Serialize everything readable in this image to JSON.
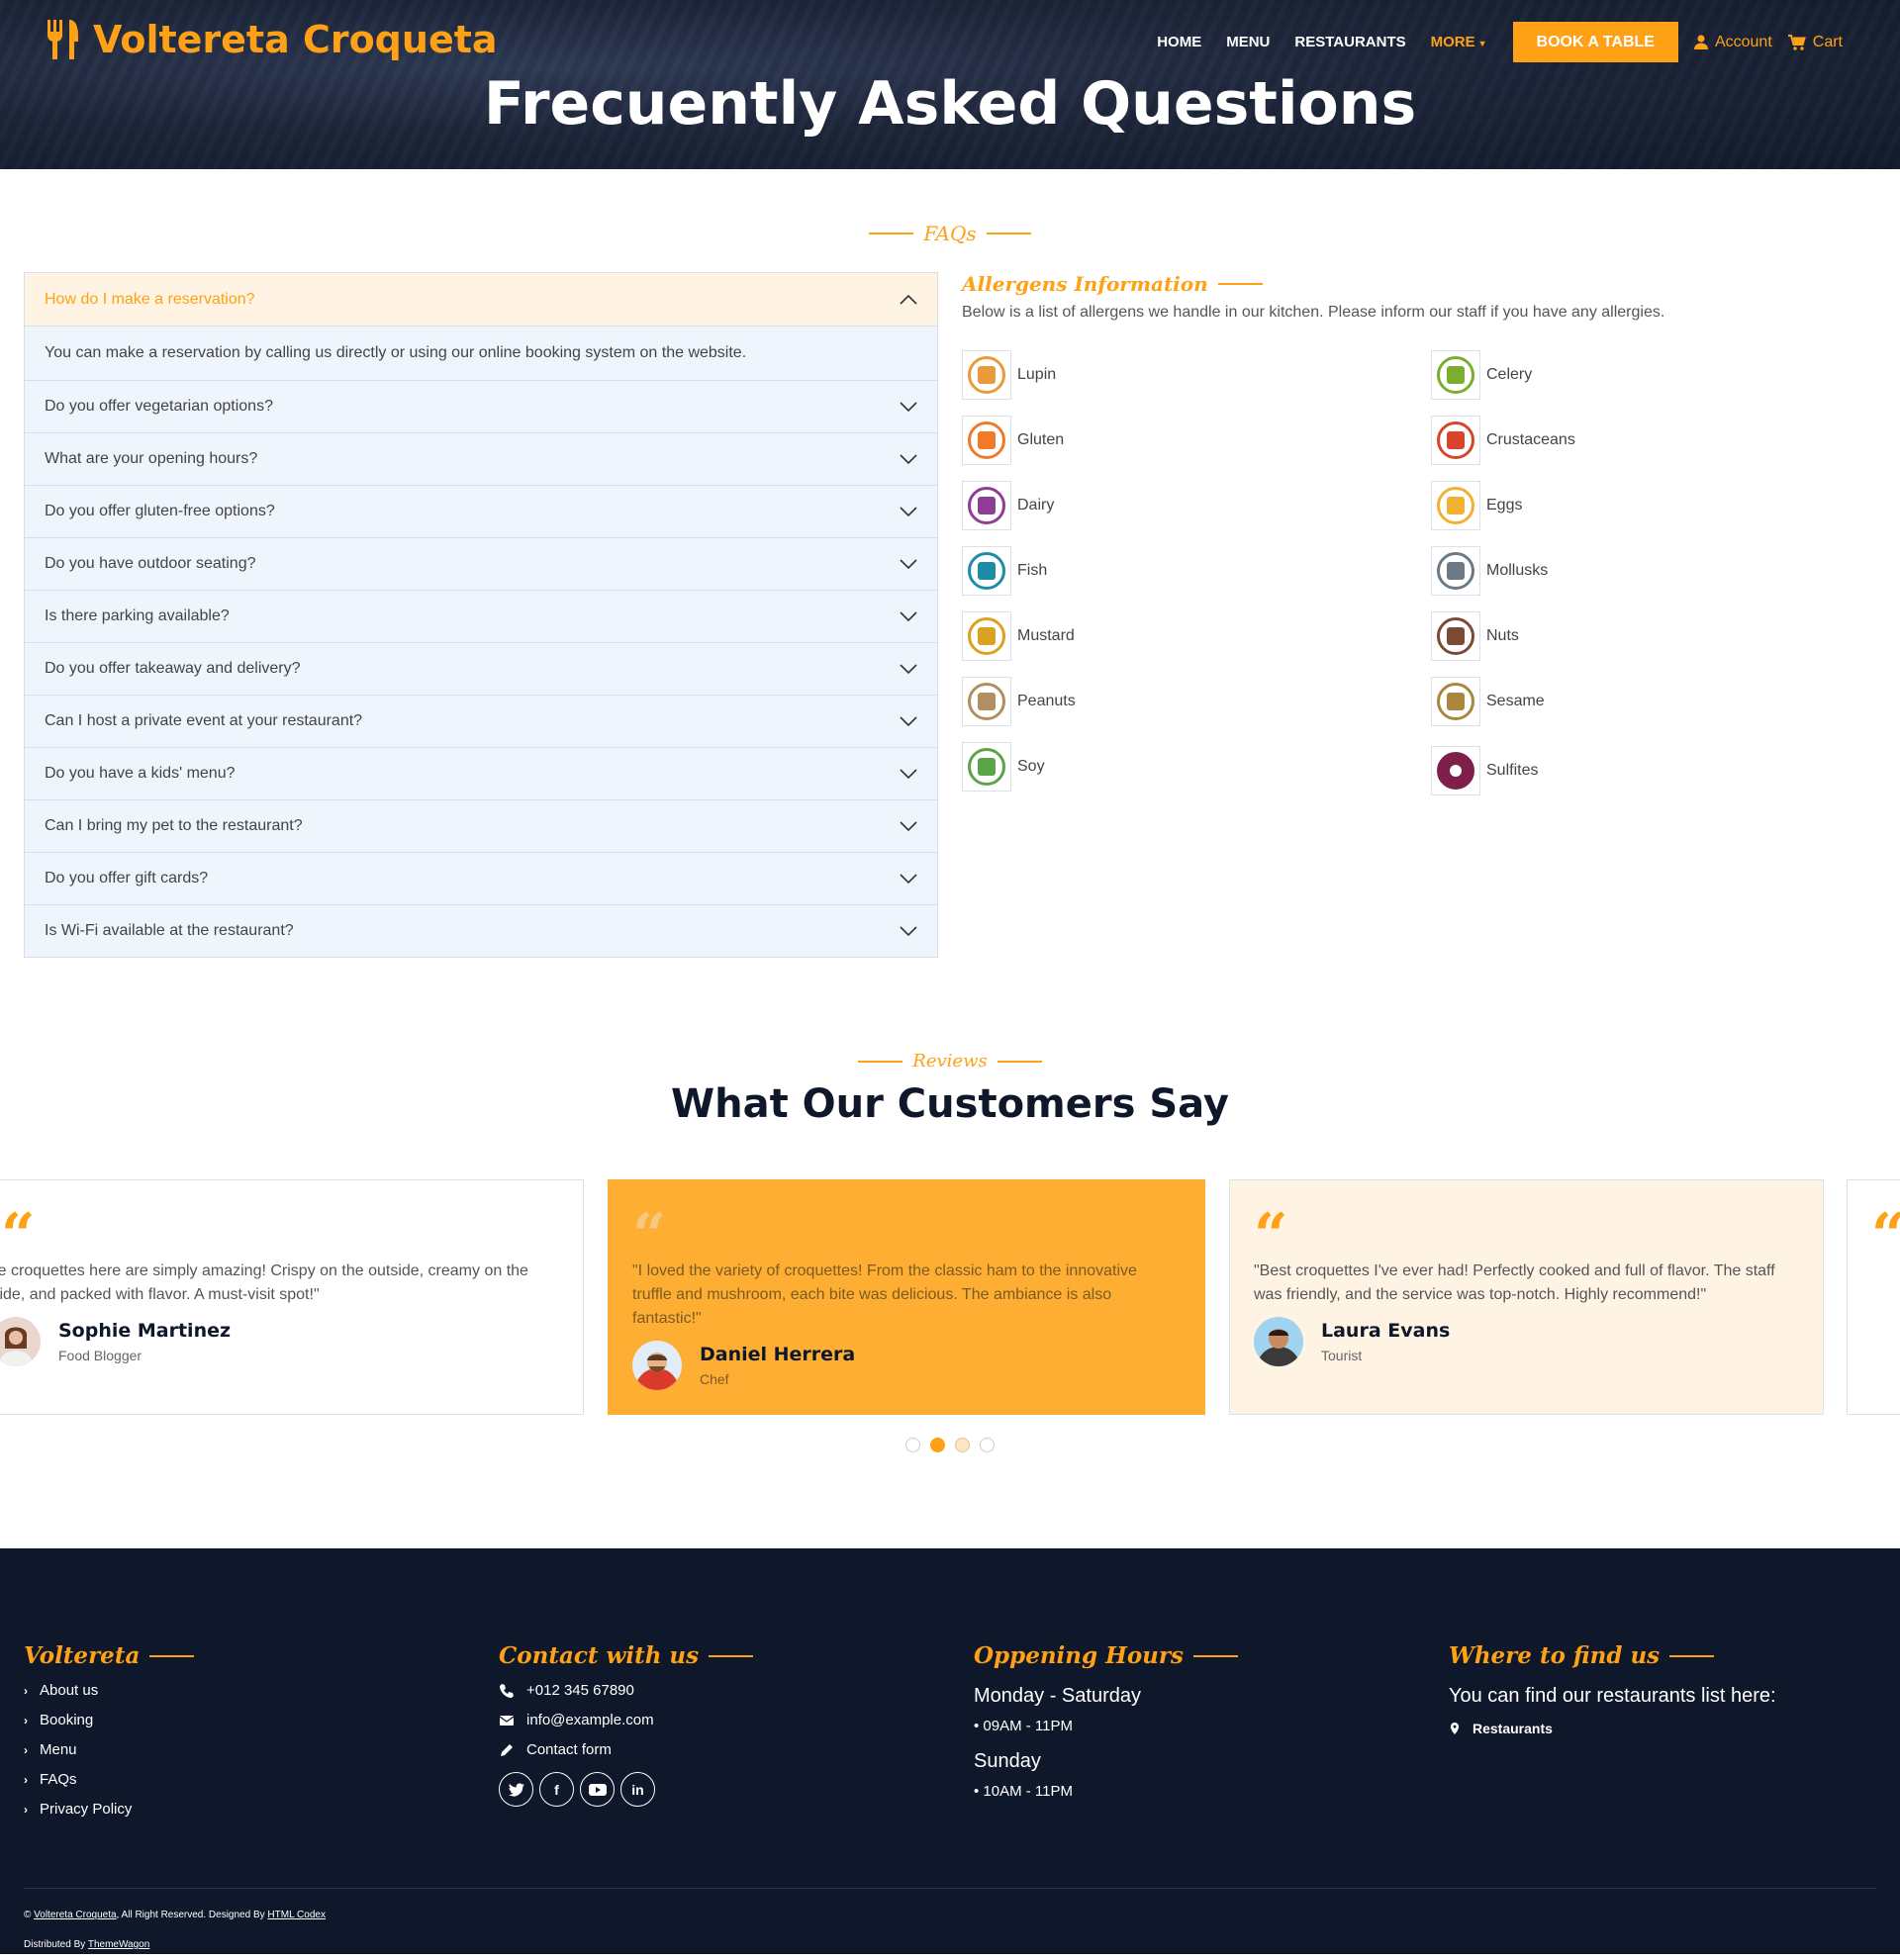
{
  "brand": {
    "name": "Voltereta Croqueta"
  },
  "nav": {
    "home": "HOME",
    "menu": "MENU",
    "restaurants": "RESTAURANTS",
    "more": "MORE",
    "book": "BOOK A TABLE",
    "account": "Account",
    "cart": "Cart"
  },
  "hero": {
    "title": "Frecuently Asked Questions"
  },
  "faq": {
    "tag": "FAQs",
    "items": [
      {
        "q": "How do I make a reservation?",
        "a": "You can make a reservation by calling us directly or using our online booking system on the website."
      },
      {
        "q": "Do you offer vegetarian options?"
      },
      {
        "q": "What are your opening hours?"
      },
      {
        "q": "Do you offer gluten-free options?"
      },
      {
        "q": "Do you have outdoor seating?"
      },
      {
        "q": "Is there parking available?"
      },
      {
        "q": "Do you offer takeaway and delivery?"
      },
      {
        "q": "Can I host a private event at your restaurant?"
      },
      {
        "q": "Do you have a kids' menu?"
      },
      {
        "q": "Can I bring my pet to the restaurant?"
      },
      {
        "q": "Do you offer gift cards?"
      },
      {
        "q": "Is Wi-Fi available at the restaurant?"
      }
    ]
  },
  "allergens": {
    "title": "Allergens Information",
    "desc": "Below is a list of allergens we handle in our kitchen. Please inform our staff if you have any allergies.",
    "items": [
      {
        "name": "Lupin",
        "color": "#E99A3B"
      },
      {
        "name": "Celery",
        "color": "#7BAE2E"
      },
      {
        "name": "Gluten",
        "color": "#F07A2A"
      },
      {
        "name": "Crustaceans",
        "color": "#D9452B"
      },
      {
        "name": "Dairy",
        "color": "#8E3E94"
      },
      {
        "name": "Eggs",
        "color": "#F2B132"
      },
      {
        "name": "Fish",
        "color": "#1C8DA5"
      },
      {
        "name": "Mollusks",
        "color": "#6B7A86"
      },
      {
        "name": "Mustard",
        "color": "#D9A21F"
      },
      {
        "name": "Nuts",
        "color": "#7A4A35"
      },
      {
        "name": "Peanuts",
        "color": "#B28E61"
      },
      {
        "name": "Sesame",
        "color": "#A9873F"
      },
      {
        "name": "Soy",
        "color": "#5CA448"
      },
      {
        "name": "Sulfites",
        "color": "#7E1F4C"
      }
    ]
  },
  "reviews": {
    "tag": "Reviews",
    "title": "What Our Customers Say",
    "cards": [
      {
        "text": "The croquettes here are simply amazing! Crispy on the outside, creamy on the inside, and packed with flavor. A must-visit spot!\"",
        "name": "Sophie Martinez",
        "role": "Food Blogger"
      },
      {
        "text": "\"I loved the variety of croquettes! From the classic ham to the innovative truffle and mushroom, each bite was delicious. The ambiance is also fantastic!\"",
        "name": "Daniel Herrera",
        "role": "Chef"
      },
      {
        "text": "\"Best croquettes I've ever had! Perfectly cooked and full of flavor. The staff was friendly, and the service was top-notch. Highly recommend!\"",
        "name": "Laura Evans",
        "role": "Tourist"
      }
    ]
  },
  "footer": {
    "col1": {
      "title": "Voltereta",
      "links": [
        "About us",
        "Booking",
        "Menu",
        "FAQs",
        "Privacy Policy"
      ]
    },
    "col2": {
      "title": "Contact with us",
      "phone": "+012 345 67890",
      "email": "info@example.com",
      "form": "Contact form"
    },
    "col3": {
      "title": "Oppening Hours",
      "d1": "Monday - Saturday",
      "h1": "• 09AM - 11PM",
      "d2": "Sunday",
      "h2": "• 10AM - 11PM"
    },
    "col4": {
      "title": "Where to find us",
      "text": "You can find our restaurants list here:",
      "link": "Restaurants"
    },
    "copy": {
      "pre": "© ",
      "site": "Voltereta Croqueta",
      "mid": ", All Right Reserved. Designed By ",
      "designer": "HTML Codex",
      "dist": "Distributed By ",
      "distributor": "ThemeWagon"
    }
  }
}
